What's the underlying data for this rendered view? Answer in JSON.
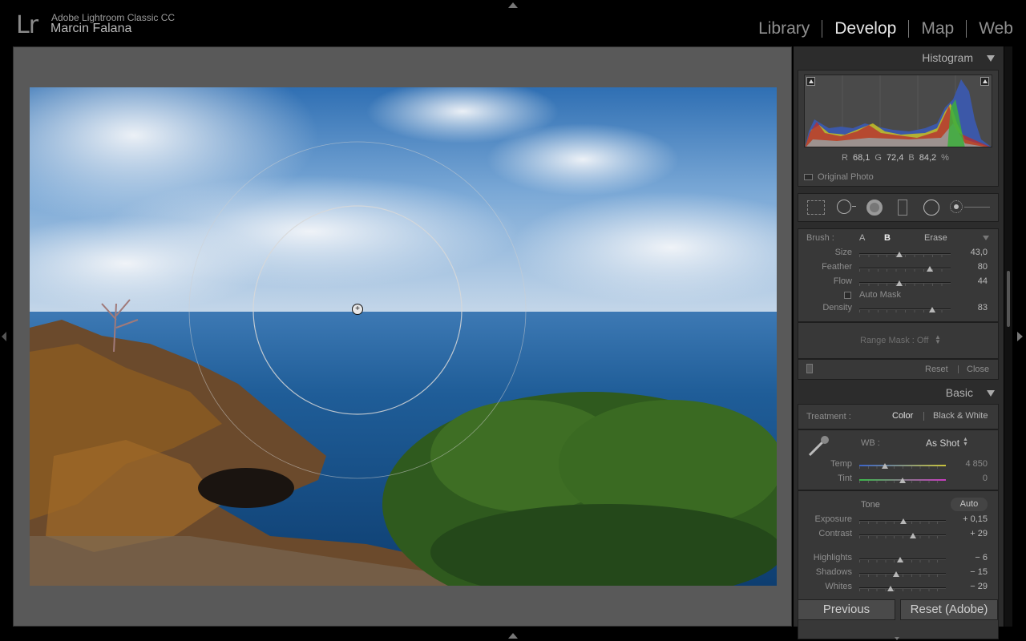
{
  "app": {
    "logo": "Lr",
    "name": "Adobe Lightroom Classic CC",
    "user": "Marcin Falana"
  },
  "modules": [
    {
      "label": "Library",
      "active": false
    },
    {
      "label": "Develop",
      "active": true
    },
    {
      "label": "Map",
      "active": false
    },
    {
      "label": "Web",
      "active": false
    }
  ],
  "histogram": {
    "title": "Histogram",
    "r_label": "R",
    "r_value": "68,1",
    "g_label": "G",
    "g_value": "72,4",
    "b_label": "B",
    "b_value": "84,2",
    "unit": "%",
    "original_photo_label": "Original Photo"
  },
  "tools": [
    "crop-overlay-icon",
    "spot-removal-icon",
    "red-eye-icon",
    "graduated-filter-icon",
    "radial-filter-icon",
    "adjustment-brush-icon"
  ],
  "brush": {
    "label": "Brush :",
    "mode_a": "A",
    "mode_b": "B",
    "mode_erase": "Erase",
    "sliders": [
      {
        "label": "Size",
        "value": "43,0",
        "pos": 0.44
      },
      {
        "label": "Feather",
        "value": "80",
        "pos": 0.77
      },
      {
        "label": "Flow",
        "value": "44",
        "pos": 0.44
      }
    ],
    "auto_mask_label": "Auto Mask",
    "density": {
      "label": "Density",
      "value": "83",
      "pos": 0.8
    },
    "range_mask_label": "Range Mask : Off",
    "reset_label": "Reset",
    "close_label": "Close"
  },
  "basic": {
    "title": "Basic",
    "treatment_label": "Treatment :",
    "treatment_color": "Color",
    "treatment_bw": "Black & White",
    "wb_label": "WB :",
    "wb_value": "As Shot",
    "temp": {
      "label": "Temp",
      "value": "4 850",
      "pos": 0.3
    },
    "tint": {
      "label": "Tint",
      "value": "0",
      "pos": 0.5
    },
    "tone_label": "Tone",
    "auto_label": "Auto",
    "exposure": {
      "label": "Exposure",
      "value": "+ 0,15",
      "pos": 0.51
    },
    "contrast": {
      "label": "Contrast",
      "value": "+ 29",
      "pos": 0.62
    },
    "highlights": {
      "label": "Highlights",
      "value": "− 6",
      "pos": 0.47
    },
    "shadows": {
      "label": "Shadows",
      "value": "− 15",
      "pos": 0.43
    },
    "whites": {
      "label": "Whites",
      "value": "− 29",
      "pos": 0.36
    }
  },
  "footer": {
    "previous_label": "Previous",
    "reset_label": "Reset (Adobe)"
  }
}
